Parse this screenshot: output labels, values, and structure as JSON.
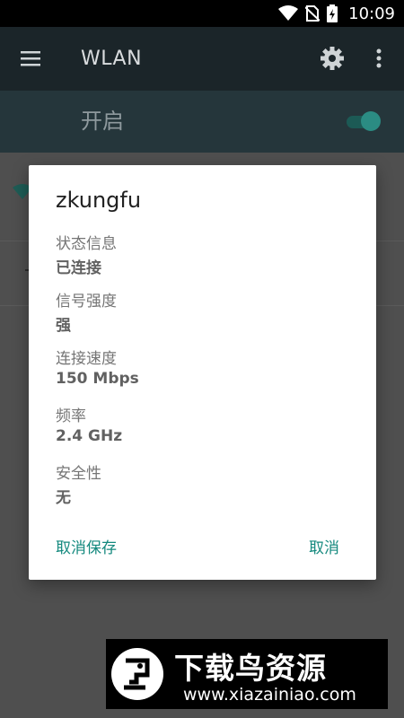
{
  "status_bar": {
    "time": "10:09",
    "icons": [
      "wifi-icon",
      "no-sim-icon",
      "battery-charging-icon"
    ]
  },
  "app_bar": {
    "title": "WLAN",
    "icons": [
      "menu-icon",
      "gear-icon",
      "more-vert-icon"
    ]
  },
  "wifi_switch": {
    "label": "开启",
    "state": "on",
    "accent": "#2b8c83"
  },
  "dialog": {
    "title": "zkungfu",
    "fields": [
      {
        "label": "状态信息",
        "value": "已连接"
      },
      {
        "label": "信号强度",
        "value": "强"
      },
      {
        "label": "连接速度",
        "value": "150 Mbps"
      },
      {
        "label": "频率",
        "value": "2.4 GHz"
      },
      {
        "label": "安全性",
        "value": "无"
      }
    ],
    "forget_button": "取消保存",
    "cancel_button": "取消",
    "button_color": "#14897e"
  },
  "watermark": {
    "name": "下载鸟资源",
    "url": "www.xiazainiao.com"
  }
}
